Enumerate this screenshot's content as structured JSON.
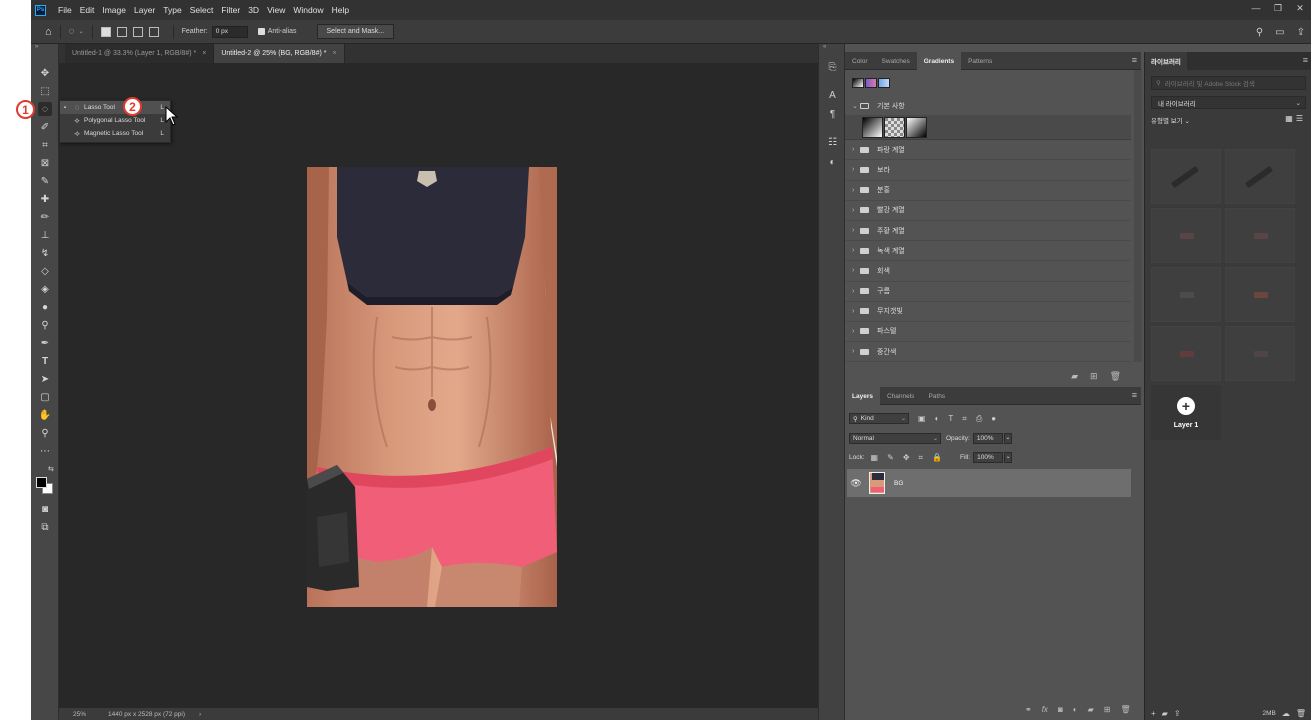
{
  "menubar": {
    "logo": "Ps",
    "items": [
      "File",
      "Edit",
      "Image",
      "Layer",
      "Type",
      "Select",
      "Filter",
      "3D",
      "View",
      "Window",
      "Help"
    ],
    "window_controls": [
      "—",
      "❐",
      "✕"
    ]
  },
  "options_bar": {
    "feather_label": "Feather:",
    "feather_value": "0 px",
    "antialias_label": "Anti-alias",
    "select_mask_label": "Select and Mask..."
  },
  "document_tabs": [
    {
      "label": "Untitled-1 @ 33.3% (Layer 1, RGB/8#) *",
      "close": "×"
    },
    {
      "label": "Untitled-2 @ 25% (BG, RGB/8#) *",
      "close": "×"
    }
  ],
  "lasso_flyout": {
    "items": [
      {
        "label": "Lasso Tool",
        "shortcut": "L"
      },
      {
        "label": "Polygonal Lasso Tool",
        "shortcut": "L"
      },
      {
        "label": "Magnetic Lasso Tool",
        "shortcut": "L"
      }
    ]
  },
  "markers": {
    "one": "1",
    "two": "2"
  },
  "status_bar": {
    "zoom": "25%",
    "doc_info": "1440 px x 2528 px (72 ppi)",
    "arrow": "›"
  },
  "gradients_panel": {
    "tabs": [
      "Color",
      "Swatches",
      "Gradients",
      "Patterns"
    ],
    "active_tab": "Gradients",
    "groups": [
      "기본 사항",
      "파랑 계열",
      "보라",
      "분홍",
      "빨강 계열",
      "주황 계열",
      "녹색 계열",
      "회색",
      "구름",
      "무지갯빛",
      "파스텔",
      "중간색"
    ]
  },
  "layers_panel": {
    "tabs": [
      "Layers",
      "Channels",
      "Paths"
    ],
    "active_tab": "Layers",
    "filter_kind": "Kind",
    "blend_mode": "Normal",
    "opacity_label": "Opacity:",
    "opacity_value": "100%",
    "lock_label": "Lock:",
    "fill_label": "Fill:",
    "fill_value": "100%",
    "layers": [
      {
        "name": "BG",
        "visible": true
      }
    ],
    "footer_fx": "fx"
  },
  "libraries_panel": {
    "title": "라이브러리",
    "search_placeholder": "라이브러리 및 Adobe Stock 검색",
    "library_select": "내 라이브러리",
    "view_label": "유형별 보기",
    "add_item_label": "Layer 1",
    "storage": "2MB"
  },
  "colors": {
    "workspace_bg": "#535353",
    "canvas_bg": "#282828",
    "marker_red": "#e03a2e",
    "selected_layer": "#6e6e6e"
  }
}
